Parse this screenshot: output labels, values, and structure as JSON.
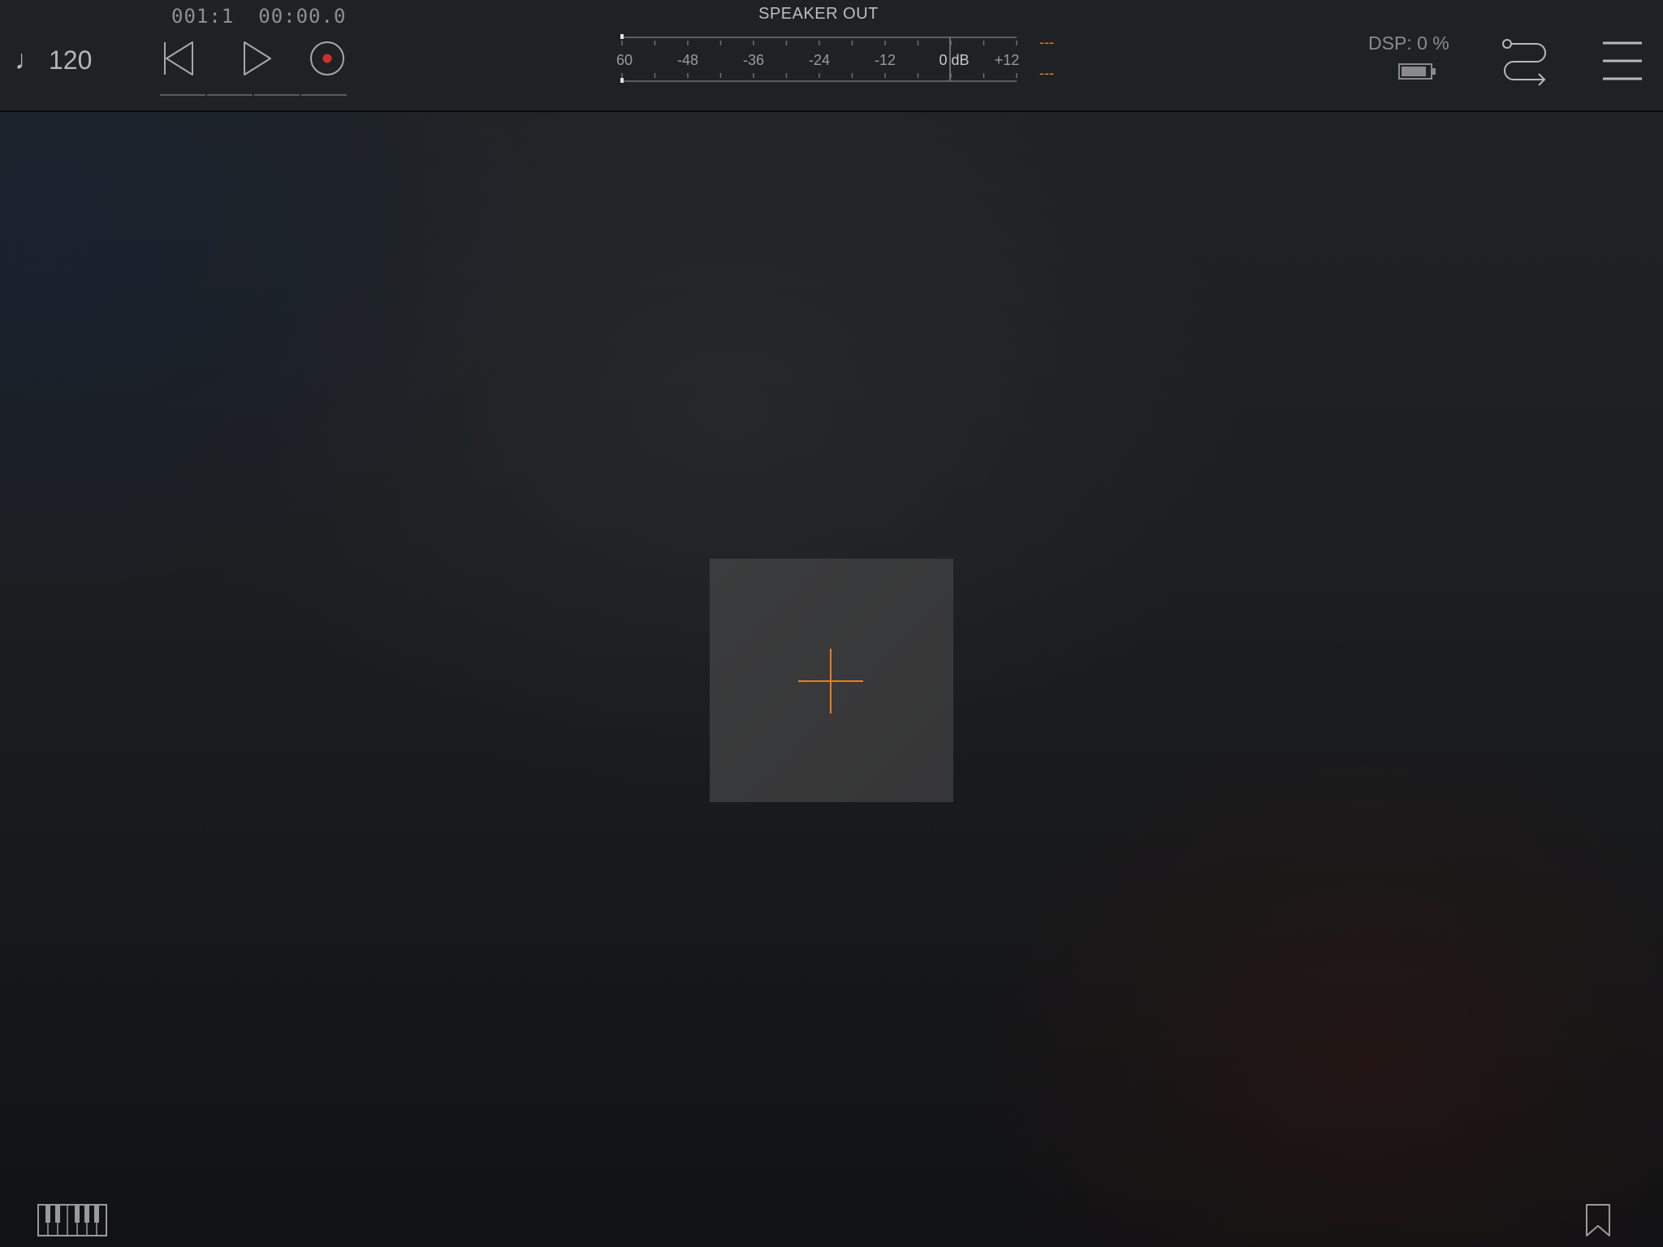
{
  "header": {
    "tempo": {
      "note_glyph": "♩",
      "value": "120"
    },
    "position": {
      "bars": "001:1",
      "time": "00:00.0"
    },
    "transport": {
      "icons": [
        "rewind-icon",
        "play-icon",
        "record-icon"
      ],
      "record_color": "#d0302a"
    },
    "meter": {
      "title": "SPEAKER OUT",
      "scale_labels": [
        "-60",
        "-48",
        "-36",
        "-24",
        "-12",
        "0 dB",
        "+12"
      ],
      "peak_left": "---",
      "peak_right": "---",
      "peak_color": "#e87d1e"
    },
    "dsp": {
      "label": "DSP:",
      "value": "0 %"
    },
    "battery_icon": "battery-icon",
    "routing_icon": "routing-icon",
    "menu_icon": "hamburger-menu-icon"
  },
  "main": {
    "add_tile": {
      "icon": "plus-icon",
      "accent": "#e87d1e"
    }
  },
  "footer": {
    "keyboard_icon": "piano-keyboard-icon",
    "bookmark_icon": "bookmark-icon"
  }
}
